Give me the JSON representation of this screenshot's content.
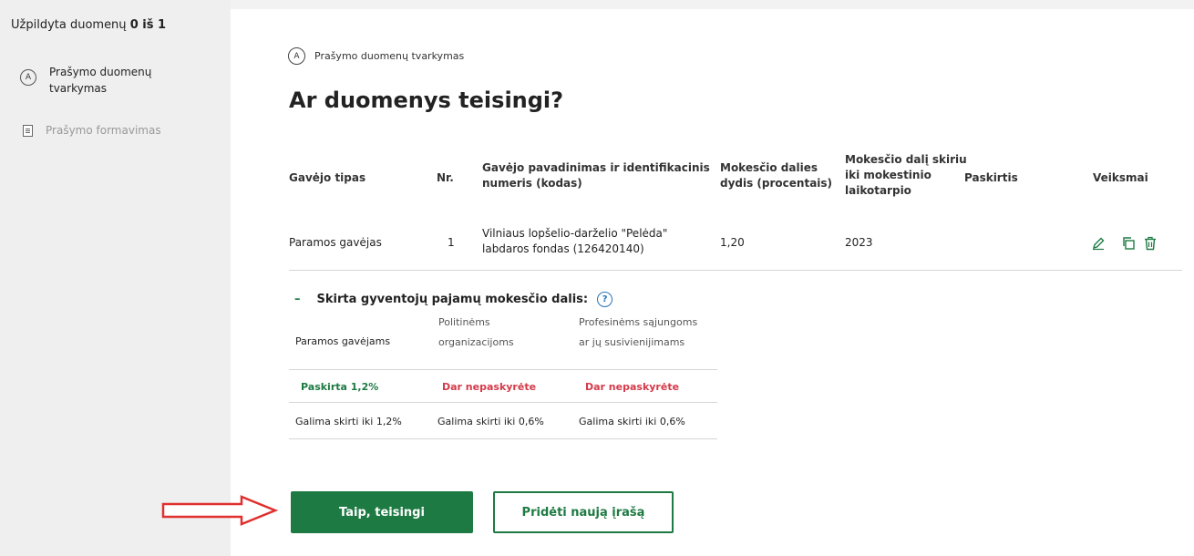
{
  "sidebar": {
    "progress_prefix": "Užpildyta duomenų",
    "progress_value": "0 iš 1",
    "steps": [
      {
        "badge": "A",
        "line1": "Prašymo duomenų",
        "line2": "tvarkymas"
      },
      {
        "icon": "document-icon",
        "label": "Prašymo formavimas"
      }
    ]
  },
  "main": {
    "crumb_badge": "A",
    "crumb_label": "Prašymo duomenų tvarkymas",
    "title": "Ar duomenys teisingi?",
    "table": {
      "headers": {
        "type": "Gavėjo tipas",
        "nr": "Nr.",
        "name_l1": "Gavėjo pavadinimas ir identifikacinis",
        "name_l2": "numeris (kodas)",
        "share_l1": "Mokesčio dalies",
        "share_l2": "dydis (procentais)",
        "period_l1": "Mokesčio dalį skiriu",
        "period_l2": "iki mokestinio",
        "period_l3": "laikotarpio",
        "purpose": "Paskirtis",
        "actions": "Veiksmai"
      },
      "row": {
        "type": "Paramos gavėjas",
        "nr": "1",
        "name_l1": "Vilniaus lopšelio-darželio \"Pelėda\"",
        "name_l2": "labdaros fondas (126420140)",
        "share": "1,20",
        "period": "2023"
      },
      "action_icons": [
        "pencil-icon",
        "copy-icon",
        "trash-icon"
      ]
    },
    "summary": {
      "toggle": "–",
      "title": "Skirta gyventojų pajamų mokesčio dalis:",
      "col1_l1": "Paramos gavėjams",
      "col2_l1": "Politinėms",
      "col2_l2": "organizacijoms",
      "col3_l1": "Profesinėms sąjungoms",
      "col3_l2": "ar jų susivienijimams",
      "status1": "Paskirta 1,2%",
      "status2": "Dar nepaskyrėte",
      "status3": "Dar nepaskyrėte",
      "limit1": "Galima skirti iki 1,2%",
      "limit2": "Galima skirti iki 0,6%",
      "limit3": "Galima skirti iki 0,6%"
    },
    "buttons": {
      "confirm": "Taip, teisingi",
      "add": "Pridėti naują įrašą"
    }
  },
  "colors": {
    "accent_green": "#1e7a43",
    "warning_red": "#d43a4a",
    "help_blue": "#2a73b8",
    "annotation_arrow": "#e03030"
  }
}
